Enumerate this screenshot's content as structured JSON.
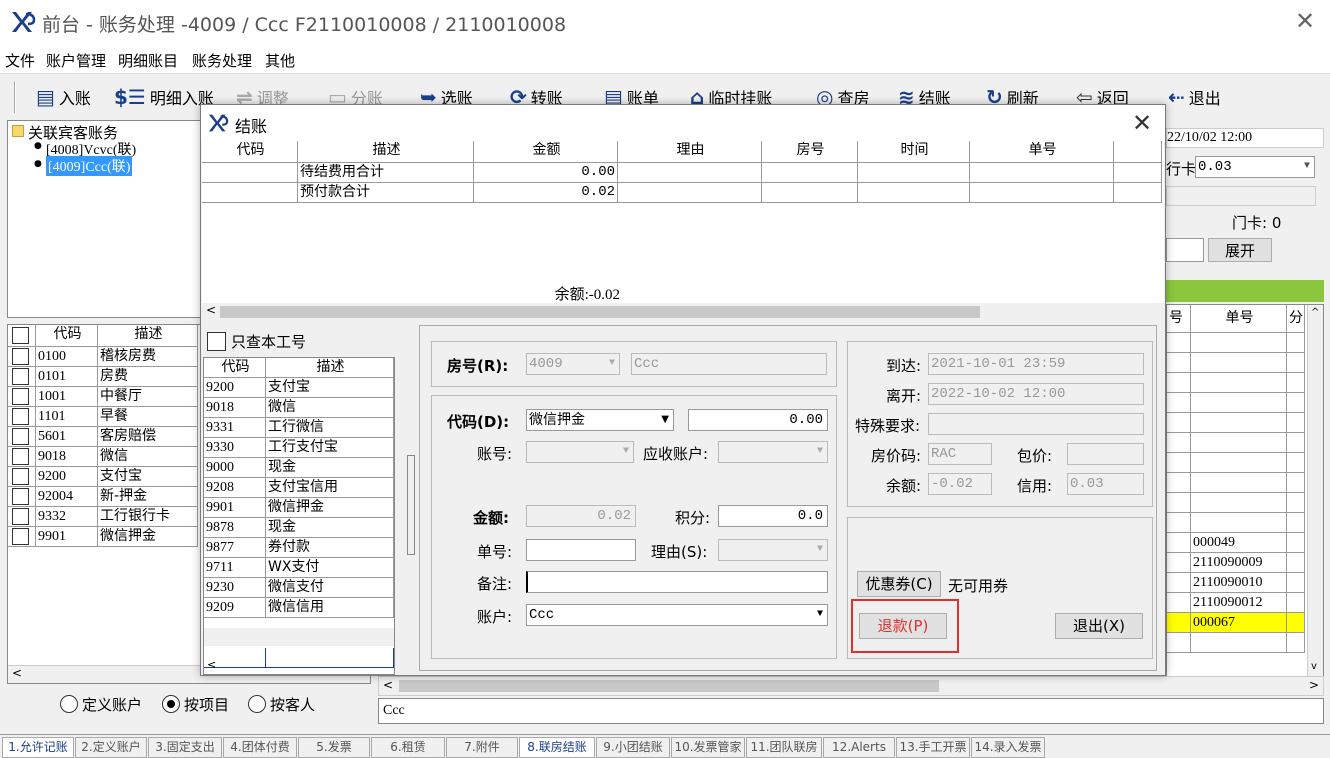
{
  "window": {
    "title": "前台 - 账务处理 -4009  /  Ccc  F2110010008  /  2110010008"
  },
  "menu": [
    "文件",
    "账户管理",
    "明细账目",
    "账务处理",
    "其他"
  ],
  "toolbar": {
    "post": "入账",
    "detail_post": "明细入账",
    "adjust": "调整",
    "split": "分账",
    "select": "选账",
    "transfer": "转账",
    "bill": "账单",
    "temp_hang": "临时挂账",
    "check_room": "查房",
    "checkout": "结账",
    "refresh": "刷新",
    "back": "返回",
    "exit": "退出"
  },
  "tree": {
    "root": "关联宾客账务",
    "items": [
      "[4008]Vcvc(联)",
      "[4009]Ccc(联)"
    ]
  },
  "left_grid": {
    "headers": [
      "代码",
      "描述"
    ],
    "rows": [
      [
        "0100",
        "稽核房费"
      ],
      [
        "0101",
        "房费"
      ],
      [
        "1001",
        "中餐厅"
      ],
      [
        "1101",
        "早餐"
      ],
      [
        "5601",
        "客房赔偿"
      ],
      [
        "9018",
        "微信"
      ],
      [
        "9200",
        "支付宝"
      ],
      [
        "92004",
        "新-押金"
      ],
      [
        "9332",
        "工行银行卡"
      ],
      [
        "9901",
        "微信押金"
      ]
    ]
  },
  "radios": {
    "define_account": "定义账户",
    "by_item": "按项目",
    "by_guest": "按客人"
  },
  "right_panel": {
    "depart": "22/10/02 12:00",
    "card_label": "行卡",
    "card_value": "0.03",
    "door_card": "门卡: 0",
    "expand": "展开",
    "grid_headers": [
      "号",
      "单号",
      "分"
    ],
    "bill_nos": [
      "000049",
      "2110090009",
      "2110090010",
      "2110090012",
      "000067"
    ],
    "status_text": "Ccc"
  },
  "dialog": {
    "title": "结账",
    "grid_headers": [
      "代码",
      "描述",
      "金额",
      "理由",
      "房号",
      "时间",
      "单号"
    ],
    "rows": [
      {
        "desc": "待结费用合计",
        "amount": "0.00"
      },
      {
        "desc": "预付款合计",
        "amount": "0.02"
      }
    ],
    "balance": "余额:-0.02",
    "only_my_job": "只查本工号",
    "pay_list_headers": [
      "代码",
      "描述"
    ],
    "pay_list": [
      [
        "9200",
        "支付宝"
      ],
      [
        "9018",
        "微信"
      ],
      [
        "9331",
        "工行微信"
      ],
      [
        "9330",
        "工行支付宝"
      ],
      [
        "9000",
        "现金"
      ],
      [
        "9208",
        "支付宝信用"
      ],
      [
        "9901",
        "微信押金"
      ],
      [
        "9878",
        "现金"
      ],
      [
        "9877",
        "券付款"
      ],
      [
        "9711",
        "WX支付"
      ],
      [
        "9230",
        "微信支付"
      ],
      [
        "9209",
        "微信信用"
      ]
    ],
    "form": {
      "room_label": "房号(R):",
      "room_no": "4009",
      "room_name": "Ccc",
      "code_label": "代码(D):",
      "code_value": "微信押金",
      "code_amount": "0.00",
      "account_no_label": "账号:",
      "receivable_label": "应收账户:",
      "amount_label": "金额:",
      "amount_value": "0.02",
      "points_label": "积分:",
      "points_value": "0.0",
      "bill_no_label": "单号:",
      "reason_label": "理由(S):",
      "remark_label": "备注:",
      "account_label": "账户:",
      "account_value": "Ccc"
    },
    "info": {
      "arrive_label": "到达:",
      "arrive": "2021-10-01 23:59",
      "depart_label": "离开:",
      "depart": "2022-10-02 12:00",
      "special_label": "特殊要求:",
      "rate_code_label": "房价码:",
      "rate_code": "RAC",
      "package_label": "包价:",
      "balance_label": "余额:",
      "balance": "-0.02",
      "credit_label": "信用:",
      "credit": "0.03"
    },
    "coupon_button": "优惠券(C)",
    "coupon_status": "无可用券",
    "refund_button": "退款(P)",
    "exit_button": "退出(X)"
  },
  "tabs": [
    "1.允许记账",
    "2.定义账户",
    "3.固定支出",
    "4.团体付费",
    "5.发票",
    "6.租赁",
    "7.附件",
    "8.联房结账",
    "9.小团结账",
    "10.发票管家",
    "11.团队联房",
    "12.Alerts",
    "13.手工开票",
    "14.录入发票"
  ],
  "colors": {
    "accent": "#1a3f8a",
    "selection": "#3399ff",
    "highlight_row": "#ffff00",
    "refund_outline": "#e03030",
    "green_bar": "#8cc63f"
  }
}
